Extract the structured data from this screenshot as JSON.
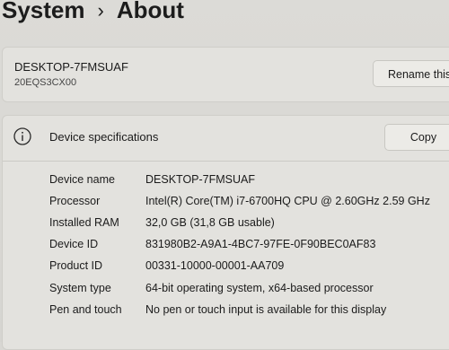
{
  "breadcrumb": {
    "parent": "System",
    "separator": "›",
    "current": "About"
  },
  "device": {
    "name": "DESKTOP-7FMSUAF",
    "model": "20EQS3CX00",
    "rename_label": "Rename this"
  },
  "specs": {
    "title": "Device specifications",
    "copy_label": "Copy",
    "rows": [
      {
        "label": "Device name",
        "value": "DESKTOP-7FMSUAF"
      },
      {
        "label": "Processor",
        "value": "Intel(R) Core(TM) i7-6700HQ CPU @ 2.60GHz   2.59 GHz"
      },
      {
        "label": "Installed RAM",
        "value": "32,0 GB (31,8 GB usable)"
      },
      {
        "label": "Device ID",
        "value": "831980B2-A9A1-4BC7-97FE-0F90BEC0AF83"
      },
      {
        "label": "Product ID",
        "value": "00331-10000-00001-AA709"
      },
      {
        "label": "System type",
        "value": "64-bit operating system, x64-based processor"
      },
      {
        "label": "Pen and touch",
        "value": "No pen or touch input is available for this display"
      }
    ]
  },
  "icons": {
    "info": "info-icon"
  }
}
